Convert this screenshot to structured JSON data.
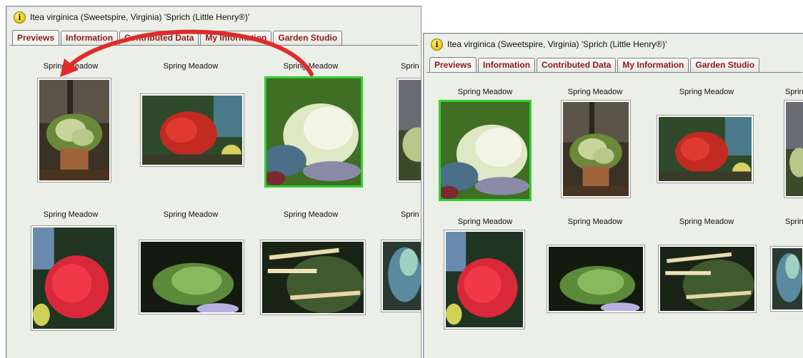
{
  "window": {
    "title": "Itea virginica (Sweetspire, Virginia) 'Sprich (Little Henry®)'"
  },
  "tabs": [
    {
      "label": "Previews"
    },
    {
      "label": "Information"
    },
    {
      "label": "Contributed Data"
    },
    {
      "label": "My Information"
    },
    {
      "label": "Garden Studio"
    }
  ],
  "grid": {
    "label": "Spring Meadow",
    "truncated_label": "Sprin"
  },
  "icons": {
    "info": "info-icon",
    "reorder_arrow": "curved-arrow-icon"
  },
  "colors": {
    "tab_text": "#8b1a1a",
    "selection_border": "#2fd22f",
    "arrow": "#e02b2b"
  }
}
